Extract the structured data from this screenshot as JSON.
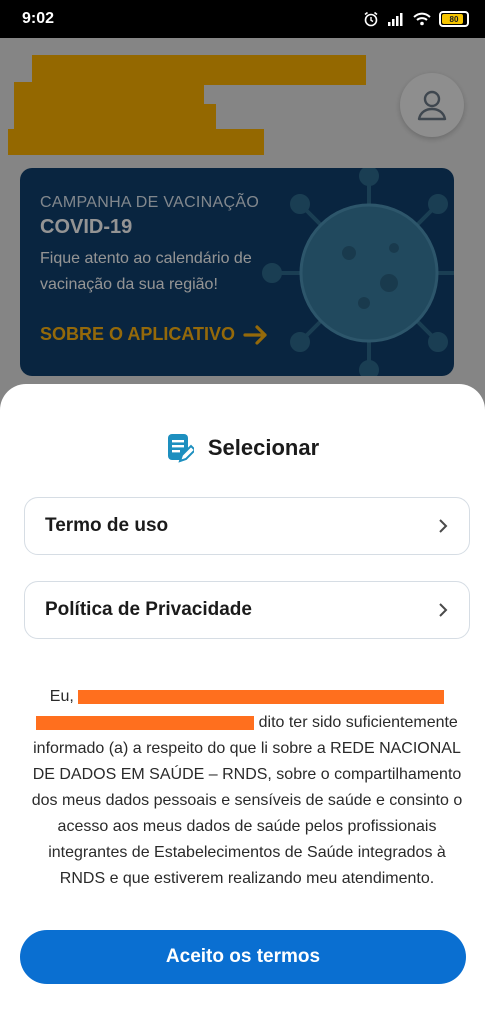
{
  "status_bar": {
    "time": "9:02",
    "battery_level": "80"
  },
  "banner": {
    "subtitle": "CAMPANHA DE VACINAÇÃO",
    "title": "COVID-19",
    "text": "Fique atento ao calendário de vacinação da sua região!",
    "cta": "SOBRE O APLICATIVO"
  },
  "sheet": {
    "title": "Selecionar",
    "options": [
      {
        "label": "Termo de uso"
      },
      {
        "label": "Política de Privacidade"
      }
    ],
    "consent_prefix": "Eu,",
    "consent_text": "dito ter sido suficientemente informado (a) a respeito do que li sobre a REDE NACIONAL DE DADOS EM SAÚDE – RNDS, sobre o compartilhamento dos meus dados pessoais e sensíveis de saúde e consinto o acesso aos meus dados de saúde pelos profissionais integrantes de Estabelecimentos de Saúde integrados à RNDS e que estiverem realizando meu atendimento.",
    "accept_label": "Aceito os termos"
  },
  "colors": {
    "primary_button": "#0a6fd1",
    "banner_bg": "#10406e",
    "banner_cta": "#ffb612",
    "redaction_yellow": "#ffb400",
    "redaction_orange": "#ff6f1e"
  }
}
